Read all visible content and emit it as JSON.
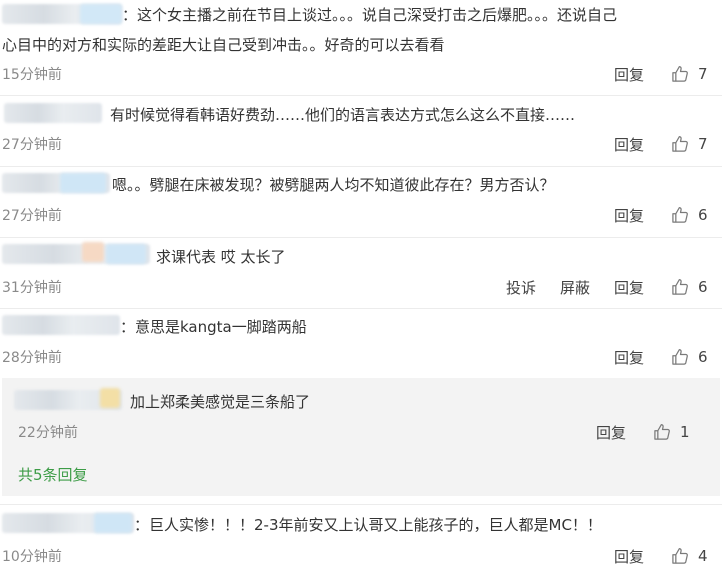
{
  "reply_label": "回复",
  "report_label": "投诉",
  "block_label": "屏蔽",
  "comments": [
    {
      "lines": [
        "：这个女主播之前在节目上谈过。。。说自己深受打击之后爆肥。。。还说自己",
        "心目中的对方和实际的差距大让自己受到冲击。。好奇的可以去看看"
      ],
      "time": "15分钟前",
      "likes": "7"
    },
    {
      "lines": [
        "有时候觉得看韩语好费劲……他们的语言表达方式怎么这么不直接……"
      ],
      "time": "27分钟前",
      "likes": "7"
    },
    {
      "lines": [
        "嗯。。劈腿在床被发现？被劈腿两人均不知道彼此存在？男方否认？"
      ],
      "time": "27分钟前",
      "likes": "6"
    },
    {
      "lines": [
        "求课代表 哎 太长了"
      ],
      "time": "31分钟前",
      "likes": "6"
    },
    {
      "lines": [
        "：意思是kangta一脚踏两船"
      ],
      "time": "28分钟前",
      "likes": "6"
    },
    {
      "lines": [
        "：巨人实惨！！！2-3年前安又上认哥又上能孩子的，巨人都是MC！！"
      ],
      "time": "10分钟前",
      "likes": "4"
    }
  ],
  "reply": {
    "text": "加上郑柔美感觉是三条船了",
    "time": "22分钟前",
    "likes": "1",
    "more_label": "共5条回复"
  }
}
